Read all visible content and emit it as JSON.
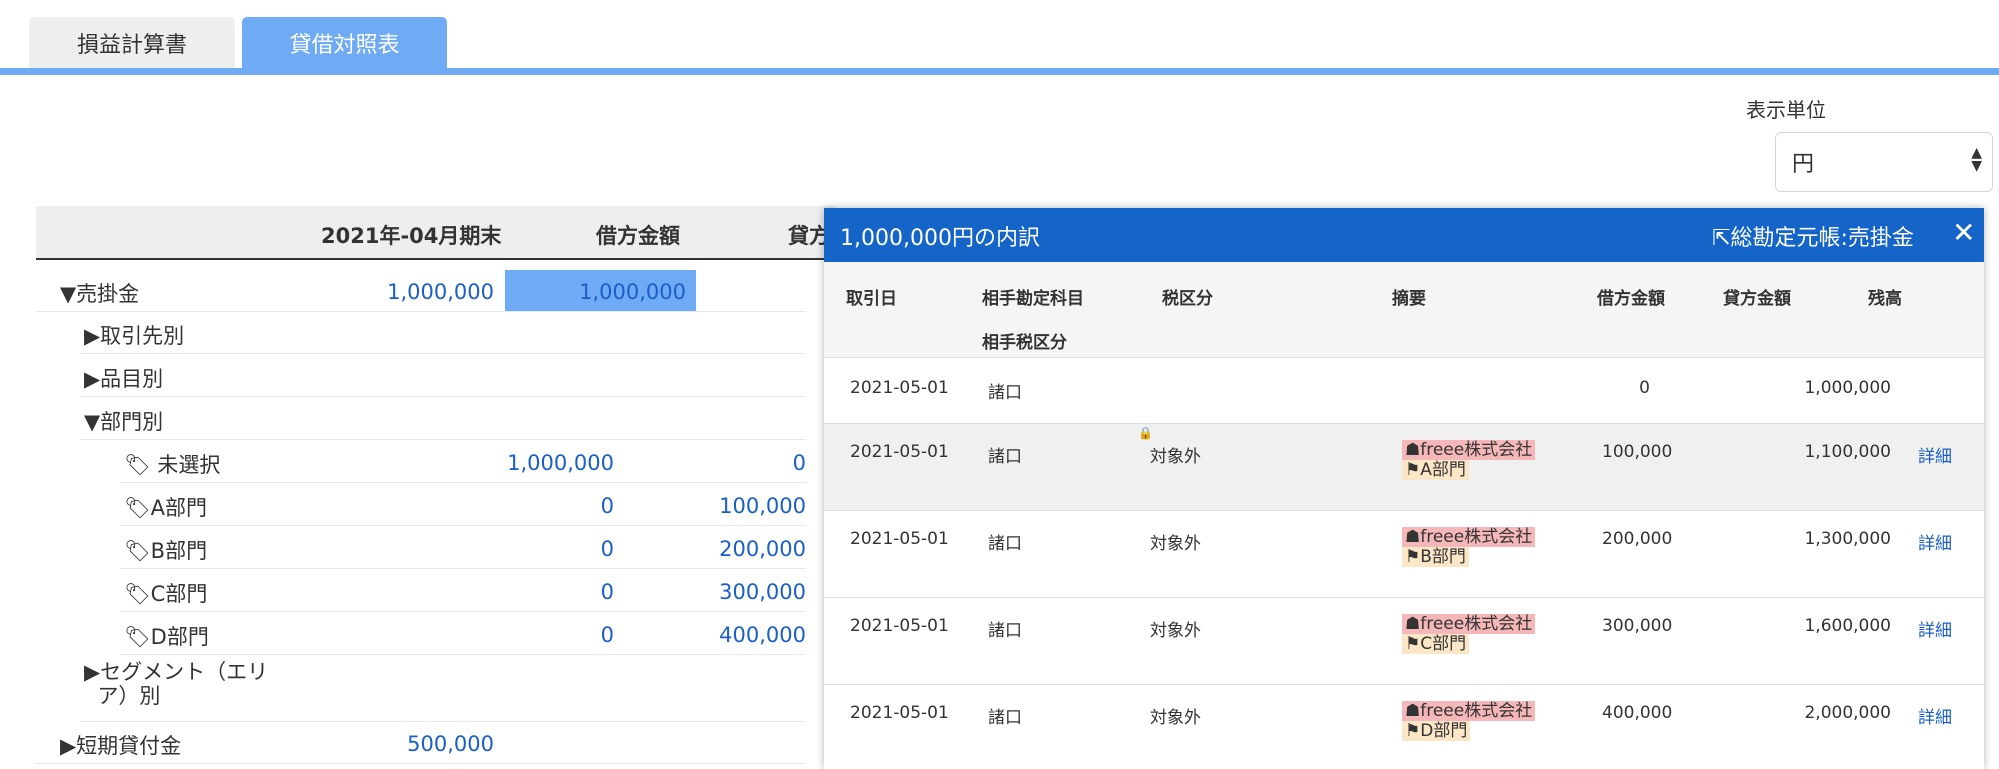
{
  "tabs": [
    {
      "label": "損益計算書"
    },
    {
      "label": "貸借対照表"
    }
  ],
  "unit": {
    "label": "表示単位",
    "selected": "円"
  },
  "main_table": {
    "headers": [
      "2021年-04月期末",
      "借方金額",
      "貸方"
    ],
    "rows": [
      {
        "label": "▼売掛金",
        "balance": "1,000,000",
        "debit": "1,000,000"
      },
      {
        "label": "▶取引先別",
        "balance": "",
        "debit": ""
      },
      {
        "label": "▶品目別",
        "balance": "",
        "debit": ""
      },
      {
        "label": "▼部門別",
        "balance": "",
        "debit": ""
      },
      {
        "label": "未選択",
        "balance": "1,000,000",
        "debit": "0"
      },
      {
        "label": "A部門",
        "balance": "0",
        "debit": "100,000"
      },
      {
        "label": "B部門",
        "balance": "0",
        "debit": "200,000"
      },
      {
        "label": "C部門",
        "balance": "0",
        "debit": "300,000"
      },
      {
        "label": "D部門",
        "balance": "0",
        "debit": "400,000"
      },
      {
        "label_line1": "▶セグメント（エリ",
        "label_line2": "ア）別",
        "balance": "",
        "debit": ""
      },
      {
        "label": "▶短期貸付金",
        "balance": "500,000",
        "debit": ""
      }
    ]
  },
  "panel": {
    "title": "1,000,000円の内訳",
    "ledger_link": "総勘定元帳:売掛金",
    "close": "✕",
    "headers": {
      "date": "取引日",
      "account": "相手勘定科目",
      "account_tax": "相手税区分",
      "tax": "税区分",
      "memo": "摘要",
      "debit": "借方金額",
      "credit": "貸方金額",
      "balance": "残高"
    },
    "rows": [
      {
        "date": "2021-05-01",
        "account": "諸口",
        "tax": "",
        "partner": "",
        "dept": "",
        "debit": "0",
        "balance": "1,000,000",
        "detail": ""
      },
      {
        "date": "2021-05-01",
        "account": "諸口",
        "tax": "対象外",
        "partner": "freee株式会社",
        "dept": "A部門",
        "debit": "100,000",
        "balance": "1,100,000",
        "detail": "詳細"
      },
      {
        "date": "2021-05-01",
        "account": "諸口",
        "tax": "対象外",
        "partner": "freee株式会社",
        "dept": "B部門",
        "debit": "200,000",
        "balance": "1,300,000",
        "detail": "詳細"
      },
      {
        "date": "2021-05-01",
        "account": "諸口",
        "tax": "対象外",
        "partner": "freee株式会社",
        "dept": "C部門",
        "debit": "300,000",
        "balance": "1,600,000",
        "detail": "詳細"
      },
      {
        "date": "2021-05-01",
        "account": "諸口",
        "tax": "対象外",
        "partner": "freee株式会社",
        "dept": "D部門",
        "debit": "400,000",
        "balance": "2,000,000",
        "detail": "詳細"
      }
    ]
  }
}
